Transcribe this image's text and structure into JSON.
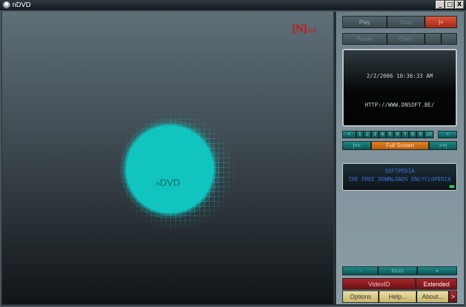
{
  "window": {
    "title": "nDVD",
    "minimize_glyph": "_",
    "maximize_glyph": "□",
    "close_glyph": "X"
  },
  "video": {
    "brand_mark": "[N]",
    "brand_text": "Soft",
    "splash_prefix": "n",
    "splash_name": "DVD"
  },
  "controls": {
    "play": "Play",
    "stop": "Stop",
    "next": "|>",
    "row2": [
      "Pause",
      "Open",
      "",
      ""
    ]
  },
  "display": {
    "datetime": "2/2/2006 10:36:33 AM",
    "url": "HTTP://WWW.DNSOFT.BE/"
  },
  "chapters": {
    "prev": "<",
    "numbers": [
      "1",
      "2",
      "3",
      "4",
      "5",
      "6",
      "7",
      "8",
      "9",
      "10"
    ],
    "next": ">",
    "rewind": "|<<",
    "title_label": "Full Screen",
    "forward": ">>|"
  },
  "info": {
    "line1": "SOFTPEDIA",
    "line2": "THE FREE DOWNLOADS ENCYCLOPEDIA"
  },
  "volume": {
    "minus": "-",
    "mute": "Mute",
    "plus": "+"
  },
  "bottom": {
    "videoid": "VideoID",
    "extended": "Extended",
    "options": "Options",
    "help": "Help...",
    "about": "About...",
    "arrow": ">"
  }
}
